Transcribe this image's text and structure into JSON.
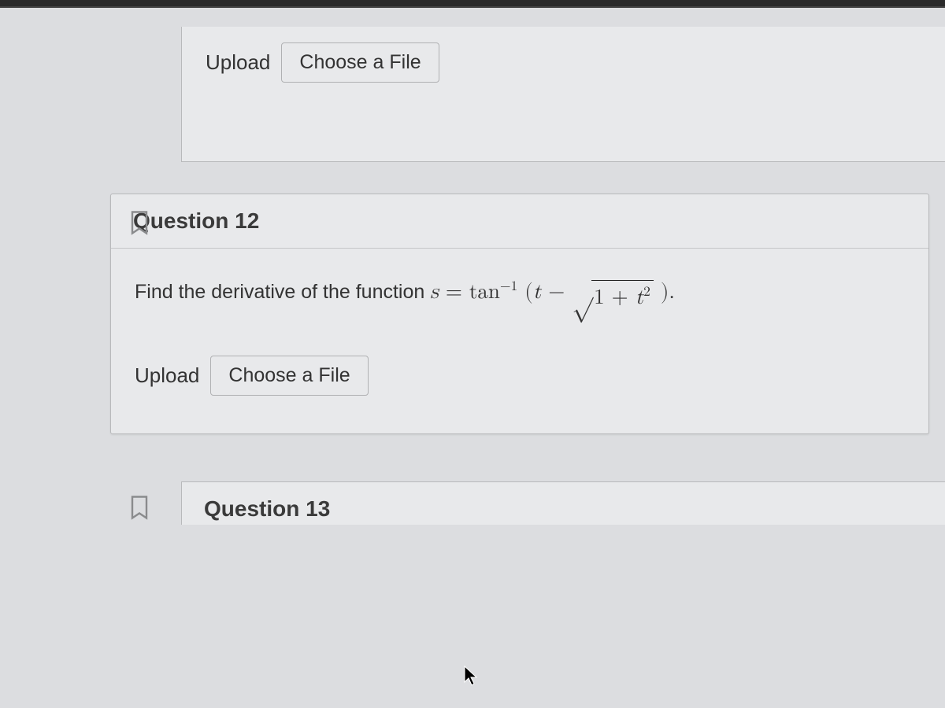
{
  "prev_question": {
    "upload_label": "Upload",
    "choose_file_label": "Choose a File"
  },
  "question12": {
    "header": "Question 12",
    "prompt_prefix": "Find the derivative of the function  ",
    "formula": {
      "lhs_var": "s",
      "eq": " = ",
      "fn": "tan",
      "sup": "−1",
      "open": "(",
      "t1": "t",
      "minus": " − ",
      "one": "1",
      "plus": " + ",
      "t2": "t",
      "sq": "2",
      "close": " )."
    },
    "upload_label": "Upload",
    "choose_file_label": "Choose a File"
  },
  "question13": {
    "header": "Question 13"
  }
}
